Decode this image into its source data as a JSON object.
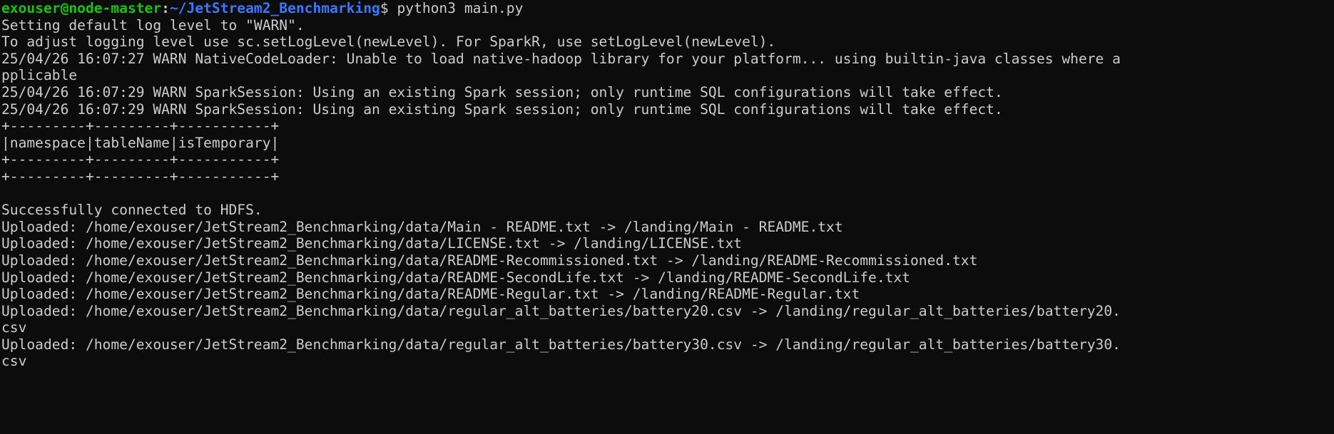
{
  "prompt": {
    "user_host": "exouser@node-master",
    "separator": ":",
    "path": "~/JetStream2_Benchmarking",
    "symbol": "$",
    "command": " python3 main.py"
  },
  "colors": {
    "background": "#0c0c0c",
    "foreground": "#cccccc",
    "prompt_user": "#16c60c",
    "prompt_path": "#3b78ff"
  },
  "output_lines": [
    "Setting default log level to \"WARN\".",
    "To adjust logging level use sc.setLogLevel(newLevel). For SparkR, use setLogLevel(newLevel).",
    "25/04/26 16:07:27 WARN NativeCodeLoader: Unable to load native-hadoop library for your platform... using builtin-java classes where a",
    "pplicable",
    "25/04/26 16:07:29 WARN SparkSession: Using an existing Spark session; only runtime SQL configurations will take effect.",
    "25/04/26 16:07:29 WARN SparkSession: Using an existing Spark session; only runtime SQL configurations will take effect.",
    "+---------+---------+-----------+",
    "|namespace|tableName|isTemporary|",
    "+---------+---------+-----------+",
    "+---------+---------+-----------+",
    "",
    "Successfully connected to HDFS.",
    "Uploaded: /home/exouser/JetStream2_Benchmarking/data/Main - README.txt -> /landing/Main - README.txt",
    "Uploaded: /home/exouser/JetStream2_Benchmarking/data/LICENSE.txt -> /landing/LICENSE.txt",
    "Uploaded: /home/exouser/JetStream2_Benchmarking/data/README-Recommissioned.txt -> /landing/README-Recommissioned.txt",
    "Uploaded: /home/exouser/JetStream2_Benchmarking/data/README-SecondLife.txt -> /landing/README-SecondLife.txt",
    "Uploaded: /home/exouser/JetStream2_Benchmarking/data/README-Regular.txt -> /landing/README-Regular.txt",
    "Uploaded: /home/exouser/JetStream2_Benchmarking/data/regular_alt_batteries/battery20.csv -> /landing/regular_alt_batteries/battery20.",
    "csv",
    "Uploaded: /home/exouser/JetStream2_Benchmarking/data/regular_alt_batteries/battery30.csv -> /landing/regular_alt_batteries/battery30.",
    "csv"
  ]
}
